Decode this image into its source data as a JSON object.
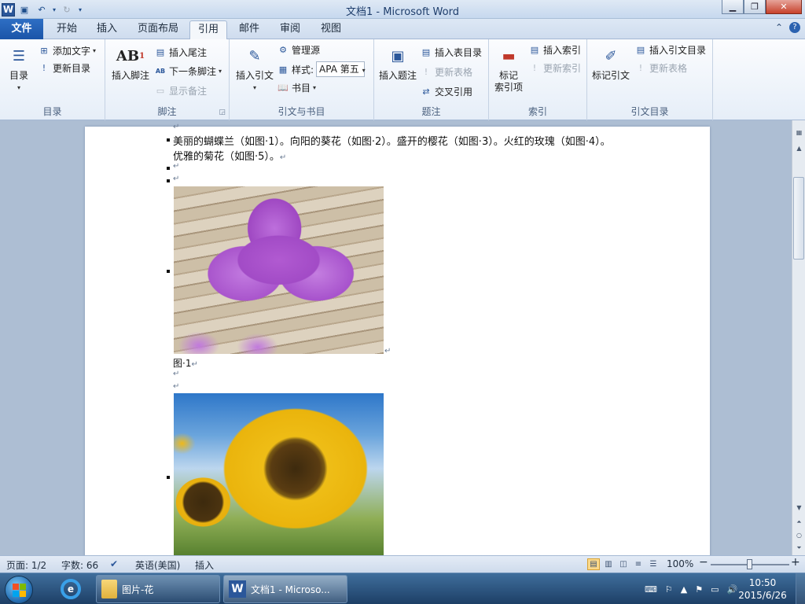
{
  "window": {
    "title": "文档1 - Microsoft Word"
  },
  "qat": {
    "logo_letter": "W"
  },
  "tabs": {
    "file": "文件",
    "items": [
      "开始",
      "插入",
      "页面布局",
      "引用",
      "邮件",
      "审阅",
      "视图"
    ],
    "active": "引用"
  },
  "ribbon": {
    "toc": {
      "label": "目录",
      "toc_button": "目录",
      "add_text": "添加文字",
      "update_toc": "更新目录"
    },
    "footnotes": {
      "label": "脚注",
      "insert_footnote": "插入脚注",
      "insert_endnote": "插入尾注",
      "next_footnote": "下一条脚注",
      "show_notes": "显示备注",
      "ab_glyph": "AB",
      "ab_sup": "1",
      "ab_small": "AB"
    },
    "citations": {
      "label": "引文与书目",
      "insert_citation": "插入引文",
      "manage_sources": "管理源",
      "style_label": "样式:",
      "style_value": "APA 第五",
      "bibliography": "书目"
    },
    "captions": {
      "label": "题注",
      "insert_caption": "插入题注",
      "insert_table_of_figures": "插入表目录",
      "update_table": "更新表格",
      "cross_reference": "交叉引用"
    },
    "index": {
      "label": "索引",
      "mark_entry": "标记\n索引项",
      "mark_entry_line1": "标记",
      "mark_entry_line2": "索引项",
      "insert_index": "插入索引",
      "update_index": "更新索引"
    },
    "authorities": {
      "label": "引文目录",
      "mark_citation": "标记引文",
      "insert_table_of_authorities": "插入引文目录",
      "update_table": "更新表格"
    }
  },
  "document": {
    "para1_line1": "美丽的蝴蝶兰（如图·1）。向阳的葵花（如图·2）。盛开的樱花（如图·3）。火红的玫瑰（如图·4）。",
    "para1_line2": "优雅的菊花（如图·5）。",
    "paragraph_mark": "↵",
    "figure1_caption": "图·1"
  },
  "status": {
    "page": "页面: 1/2",
    "words": "字数: 66",
    "language": "英语(美国)",
    "mode": "插入",
    "zoom": "100%",
    "zoom_minus": "−",
    "zoom_plus": "+"
  },
  "taskbar": {
    "folder_window": "图片-花",
    "word_window": "文档1 - Microso...",
    "time": "10:50",
    "date": "2015/6/26"
  }
}
